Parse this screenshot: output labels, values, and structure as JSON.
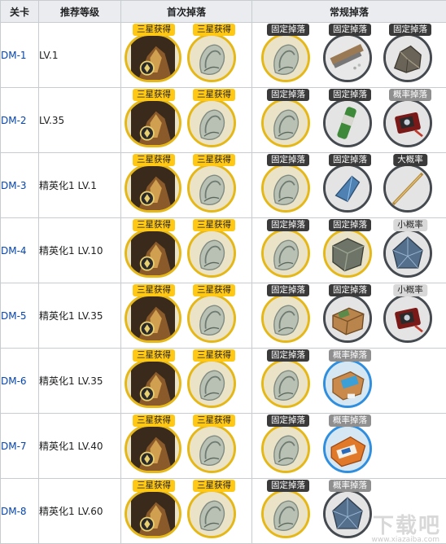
{
  "headers": {
    "stage": "关卡",
    "level": "推荐等级",
    "first": "首次掉落",
    "regular": "常规掉落"
  },
  "rows": [
    {
      "stage": "DM-1",
      "level": "LV.1",
      "first": [
        {
          "tag": "三星获得",
          "item": "operator-portrait"
        },
        {
          "tag": "三星获得",
          "item": "furniture-part"
        }
      ],
      "regular": [
        {
          "tag": "固定掉落",
          "item": "furniture-part"
        },
        {
          "tag": "固定掉落",
          "item": "building-material"
        },
        {
          "tag": "固定掉落",
          "item": "ore-material"
        }
      ]
    },
    {
      "stage": "DM-2",
      "level": "LV.35",
      "first": [
        {
          "tag": "三星获得",
          "item": "operator-portrait"
        },
        {
          "tag": "三星获得",
          "item": "furniture-part"
        }
      ],
      "regular": [
        {
          "tag": "固定掉落",
          "item": "furniture-part"
        },
        {
          "tag": "固定掉落",
          "item": "green-canister"
        },
        {
          "tag": "概率掉落",
          "item": "red-device"
        }
      ]
    },
    {
      "stage": "DM-3",
      "level": "精英化1 LV.1",
      "first": [
        {
          "tag": "三星获得",
          "item": "operator-portrait"
        },
        {
          "tag": "三星获得",
          "item": "furniture-part"
        }
      ],
      "regular": [
        {
          "tag": "固定掉落",
          "item": "furniture-part"
        },
        {
          "tag": "固定掉落",
          "item": "blue-crystal"
        },
        {
          "tag": "大概率",
          "item": "orange-rod"
        }
      ]
    },
    {
      "stage": "DM-4",
      "level": "精英化1 LV.10",
      "first": [
        {
          "tag": "三星获得",
          "item": "operator-portrait"
        },
        {
          "tag": "三星获得",
          "item": "furniture-part"
        }
      ],
      "regular": [
        {
          "tag": "固定掉落",
          "item": "furniture-part"
        },
        {
          "tag": "固定掉落",
          "item": "stone-block"
        },
        {
          "tag": "小概率",
          "item": "polyhedron"
        }
      ]
    },
    {
      "stage": "DM-5",
      "level": "精英化1 LV.35",
      "first": [
        {
          "tag": "三星获得",
          "item": "operator-portrait"
        },
        {
          "tag": "三星获得",
          "item": "furniture-part"
        }
      ],
      "regular": [
        {
          "tag": "固定掉落",
          "item": "furniture-part"
        },
        {
          "tag": "固定掉落",
          "item": "supply-crate"
        },
        {
          "tag": "小概率",
          "item": "red-device"
        }
      ]
    },
    {
      "stage": "DM-6",
      "level": "精英化1 LV.35",
      "first": [
        {
          "tag": "三星获得",
          "item": "operator-portrait"
        },
        {
          "tag": "三星获得",
          "item": "furniture-part"
        }
      ],
      "regular": [
        {
          "tag": "固定掉落",
          "item": "furniture-part"
        },
        {
          "tag": "概率掉落",
          "item": "blue-package"
        }
      ]
    },
    {
      "stage": "DM-7",
      "level": "精英化1 LV.40",
      "first": [
        {
          "tag": "三星获得",
          "item": "operator-portrait"
        },
        {
          "tag": "三星获得",
          "item": "furniture-part"
        }
      ],
      "regular": [
        {
          "tag": "固定掉落",
          "item": "furniture-part"
        },
        {
          "tag": "概率掉落",
          "item": "orange-package"
        }
      ]
    },
    {
      "stage": "DM-8",
      "level": "精英化1 LV.60",
      "first": [
        {
          "tag": "三星获得",
          "item": "operator-portrait"
        },
        {
          "tag": "三星获得",
          "item": "furniture-part"
        }
      ],
      "regular": [
        {
          "tag": "固定掉落",
          "item": "furniture-part"
        },
        {
          "tag": "概率掉落",
          "item": "polyhedron"
        }
      ]
    }
  ],
  "tag_styles": {
    "三星获得": "yellow",
    "固定掉落": "dark",
    "概率掉落": "grey",
    "大概率": "dark",
    "小概率": "light"
  },
  "ring_styles": {
    "operator-portrait": "yellow",
    "furniture-part": "yellow",
    "building-material": "gray",
    "ore-material": "gray",
    "green-canister": "gray",
    "red-device": "gray",
    "blue-crystal": "gray",
    "orange-rod": "gray",
    "stone-block": "yellow",
    "polyhedron": "gray",
    "supply-crate": "gray",
    "blue-package": "blue",
    "orange-package": "blue"
  },
  "colors": {
    "header_bg": "#eaecf0",
    "border": "#c8ccd1",
    "link": "#0645ad",
    "tag_yellow": "#ffc814",
    "tag_dark": "#3a3a3a",
    "tag_grey": "#8f8f8f",
    "tag_light": "#d8d8d8",
    "ring_gold": "#e6b817",
    "ring_gray": "#444a4f",
    "ring_blue": "#2f8fde"
  },
  "watermark": {
    "brand": "下载吧",
    "url": "www.xiazaiba.com"
  }
}
